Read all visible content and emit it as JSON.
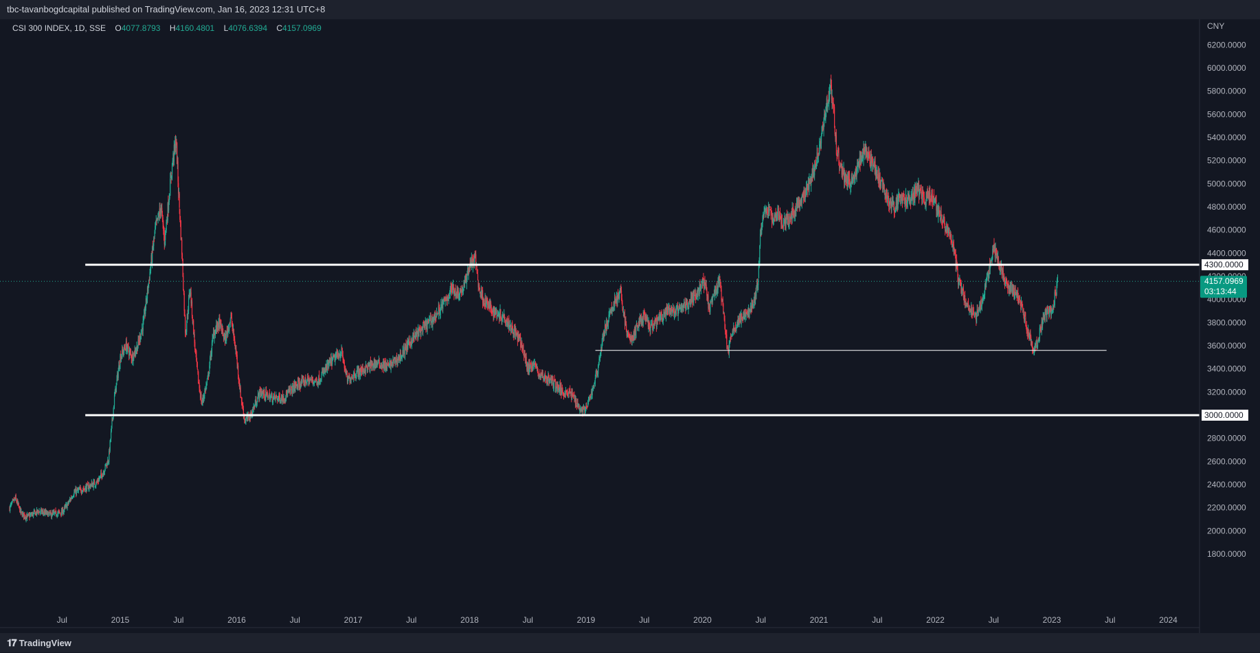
{
  "header": {
    "published_text": "tbc-tavanbogdcapital published on TradingView.com, Jan 16, 2023 12:31 UTC+8"
  },
  "legend": {
    "symbol": "CSI 300 INDEX, 1D, SSE",
    "open_label": "O",
    "open": "4077.8793",
    "high_label": "H",
    "high": "4160.4801",
    "low_label": "L",
    "low": "4076.6394",
    "close_label": "C",
    "close": "4157.0969"
  },
  "footer": {
    "brand": "TradingView",
    "logo_mark": "𝟏𝟕"
  },
  "colors": {
    "background": "#131722",
    "up": "#22ab94",
    "down": "#f23645",
    "price_tag": "#089981",
    "axis_text": "#b2b5be",
    "level_line": "#ffffff"
  },
  "chart_data": {
    "type": "line",
    "title": "CSI 300 INDEX, 1D, SSE",
    "currency": "CNY",
    "ylim": [
      1650,
      6300
    ],
    "xlim": [
      2014.05,
      2024.27
    ],
    "y_ticks": [
      "1800.0000",
      "2000.0000",
      "2200.0000",
      "2400.0000",
      "2600.0000",
      "2800.0000",
      "3000.0000",
      "3200.0000",
      "3400.0000",
      "3600.0000",
      "3800.0000",
      "4000.0000",
      "4200.0000",
      "4400.0000",
      "4600.0000",
      "4800.0000",
      "5000.0000",
      "5200.0000",
      "5400.0000",
      "5600.0000",
      "5800.0000",
      "6000.0000",
      "6200.0000"
    ],
    "x_ticks": [
      {
        "label": "Jul",
        "t": 2014.5
      },
      {
        "label": "2015",
        "t": 2015.0
      },
      {
        "label": "Jul",
        "t": 2015.5
      },
      {
        "label": "2016",
        "t": 2016.0
      },
      {
        "label": "Jul",
        "t": 2016.5
      },
      {
        "label": "2017",
        "t": 2017.0
      },
      {
        "label": "Jul",
        "t": 2017.5
      },
      {
        "label": "2018",
        "t": 2018.0
      },
      {
        "label": "Jul",
        "t": 2018.5
      },
      {
        "label": "2019",
        "t": 2019.0
      },
      {
        "label": "Jul",
        "t": 2019.5
      },
      {
        "label": "2020",
        "t": 2020.0
      },
      {
        "label": "Jul",
        "t": 2020.5
      },
      {
        "label": "2021",
        "t": 2021.0
      },
      {
        "label": "Jul",
        "t": 2021.5
      },
      {
        "label": "2022",
        "t": 2022.0
      },
      {
        "label": "Jul",
        "t": 2022.5
      },
      {
        "label": "2023",
        "t": 2023.0
      },
      {
        "label": "Jul",
        "t": 2023.5
      },
      {
        "label": "2024",
        "t": 2024.0
      }
    ],
    "horizontal_levels": [
      {
        "price": 4300,
        "label": "4300.0000",
        "style": "thick",
        "t_start": 2014.7,
        "t_end": 2024.3
      },
      {
        "price": 3000,
        "label": "3000.0000",
        "style": "thick",
        "t_start": 2014.7,
        "t_end": 2024.3
      },
      {
        "price": 3560,
        "label": "",
        "style": "thin",
        "t_start": 2019.08,
        "t_end": 2023.47
      }
    ],
    "last_price": {
      "value": 4157.0969,
      "label": "4157.0969",
      "countdown": "03:13:44"
    },
    "series": [
      {
        "price": [
          [
            2014.05,
            2200
          ],
          [
            2014.1,
            2280
          ],
          [
            2014.15,
            2150
          ],
          [
            2014.2,
            2120
          ],
          [
            2014.3,
            2170
          ],
          [
            2014.4,
            2140
          ],
          [
            2014.5,
            2160
          ],
          [
            2014.55,
            2230
          ],
          [
            2014.6,
            2330
          ],
          [
            2014.7,
            2370
          ],
          [
            2014.8,
            2420
          ],
          [
            2014.85,
            2500
          ],
          [
            2014.9,
            2620
          ],
          [
            2014.95,
            3150
          ],
          [
            2015.0,
            3500
          ],
          [
            2015.05,
            3600
          ],
          [
            2015.1,
            3500
          ],
          [
            2015.15,
            3600
          ],
          [
            2015.2,
            3800
          ],
          [
            2015.25,
            4200
          ],
          [
            2015.3,
            4600
          ],
          [
            2015.35,
            4800
          ],
          [
            2015.38,
            4500
          ],
          [
            2015.42,
            4900
          ],
          [
            2015.45,
            5200
          ],
          [
            2015.48,
            5380
          ],
          [
            2015.5,
            4950
          ],
          [
            2015.53,
            4400
          ],
          [
            2015.56,
            3700
          ],
          [
            2015.6,
            4100
          ],
          [
            2015.64,
            3600
          ],
          [
            2015.67,
            3300
          ],
          [
            2015.7,
            3100
          ],
          [
            2015.75,
            3300
          ],
          [
            2015.8,
            3700
          ],
          [
            2015.85,
            3800
          ],
          [
            2015.9,
            3650
          ],
          [
            2015.95,
            3850
          ],
          [
            2016.0,
            3500
          ],
          [
            2016.03,
            3200
          ],
          [
            2016.07,
            2950
          ],
          [
            2016.12,
            3000
          ],
          [
            2016.2,
            3200
          ],
          [
            2016.3,
            3150
          ],
          [
            2016.4,
            3150
          ],
          [
            2016.5,
            3250
          ],
          [
            2016.6,
            3300
          ],
          [
            2016.7,
            3300
          ],
          [
            2016.8,
            3450
          ],
          [
            2016.9,
            3550
          ],
          [
            2016.95,
            3300
          ],
          [
            2017.0,
            3350
          ],
          [
            2017.1,
            3400
          ],
          [
            2017.2,
            3450
          ],
          [
            2017.3,
            3420
          ],
          [
            2017.4,
            3500
          ],
          [
            2017.5,
            3650
          ],
          [
            2017.6,
            3750
          ],
          [
            2017.7,
            3850
          ],
          [
            2017.8,
            4000
          ],
          [
            2017.85,
            4100
          ],
          [
            2017.9,
            4050
          ],
          [
            2017.95,
            4100
          ],
          [
            2018.0,
            4300
          ],
          [
            2018.05,
            4350
          ],
          [
            2018.08,
            4100
          ],
          [
            2018.12,
            4000
          ],
          [
            2018.2,
            3900
          ],
          [
            2018.3,
            3850
          ],
          [
            2018.4,
            3700
          ],
          [
            2018.45,
            3600
          ],
          [
            2018.5,
            3400
          ],
          [
            2018.55,
            3450
          ],
          [
            2018.6,
            3350
          ],
          [
            2018.7,
            3300
          ],
          [
            2018.75,
            3250
          ],
          [
            2018.8,
            3200
          ],
          [
            2018.85,
            3200
          ],
          [
            2018.9,
            3150
          ],
          [
            2018.95,
            3050
          ],
          [
            2019.0,
            3050
          ],
          [
            2019.05,
            3200
          ],
          [
            2019.1,
            3400
          ],
          [
            2019.15,
            3700
          ],
          [
            2019.2,
            3850
          ],
          [
            2019.25,
            4000
          ],
          [
            2019.3,
            4050
          ],
          [
            2019.35,
            3700
          ],
          [
            2019.4,
            3650
          ],
          [
            2019.45,
            3800
          ],
          [
            2019.5,
            3850
          ],
          [
            2019.55,
            3750
          ],
          [
            2019.6,
            3800
          ],
          [
            2019.65,
            3850
          ],
          [
            2019.7,
            3900
          ],
          [
            2019.75,
            3900
          ],
          [
            2019.8,
            3900
          ],
          [
            2019.85,
            3950
          ],
          [
            2019.9,
            4000
          ],
          [
            2019.95,
            4050
          ],
          [
            2020.0,
            4150
          ],
          [
            2020.03,
            4100
          ],
          [
            2020.06,
            3900
          ],
          [
            2020.1,
            4050
          ],
          [
            2020.15,
            4150
          ],
          [
            2020.2,
            3700
          ],
          [
            2020.22,
            3550
          ],
          [
            2020.25,
            3700
          ],
          [
            2020.3,
            3800
          ],
          [
            2020.35,
            3850
          ],
          [
            2020.4,
            3900
          ],
          [
            2020.45,
            4000
          ],
          [
            2020.48,
            4200
          ],
          [
            2020.5,
            4600
          ],
          [
            2020.52,
            4700
          ],
          [
            2020.55,
            4800
          ],
          [
            2020.6,
            4700
          ],
          [
            2020.65,
            4750
          ],
          [
            2020.7,
            4650
          ],
          [
            2020.75,
            4700
          ],
          [
            2020.8,
            4800
          ],
          [
            2020.85,
            4850
          ],
          [
            2020.9,
            4950
          ],
          [
            2020.95,
            5100
          ],
          [
            2021.0,
            5300
          ],
          [
            2021.05,
            5600
          ],
          [
            2021.1,
            5850
          ],
          [
            2021.12,
            5700
          ],
          [
            2021.15,
            5300
          ],
          [
            2021.2,
            5100
          ],
          [
            2021.25,
            5000
          ],
          [
            2021.3,
            5050
          ],
          [
            2021.35,
            5200
          ],
          [
            2021.4,
            5300
          ],
          [
            2021.45,
            5200
          ],
          [
            2021.5,
            5100
          ],
          [
            2021.55,
            4950
          ],
          [
            2021.6,
            4850
          ],
          [
            2021.65,
            4800
          ],
          [
            2021.7,
            4900
          ],
          [
            2021.75,
            4850
          ],
          [
            2021.8,
            4900
          ],
          [
            2021.85,
            4950
          ],
          [
            2021.9,
            4850
          ],
          [
            2021.95,
            4900
          ],
          [
            2022.0,
            4850
          ],
          [
            2022.05,
            4700
          ],
          [
            2022.1,
            4600
          ],
          [
            2022.15,
            4500
          ],
          [
            2022.2,
            4150
          ],
          [
            2022.25,
            4000
          ],
          [
            2022.3,
            3900
          ],
          [
            2022.35,
            3850
          ],
          [
            2022.4,
            4000
          ],
          [
            2022.45,
            4200
          ],
          [
            2022.5,
            4450
          ],
          [
            2022.55,
            4300
          ],
          [
            2022.6,
            4150
          ],
          [
            2022.65,
            4100
          ],
          [
            2022.7,
            4050
          ],
          [
            2022.75,
            3900
          ],
          [
            2022.8,
            3700
          ],
          [
            2022.85,
            3550
          ],
          [
            2022.88,
            3650
          ],
          [
            2022.92,
            3800
          ],
          [
            2022.96,
            3900
          ],
          [
            2023.0,
            3900
          ],
          [
            2023.03,
            4050
          ],
          [
            2023.05,
            4157
          ]
        ]
      }
    ]
  }
}
